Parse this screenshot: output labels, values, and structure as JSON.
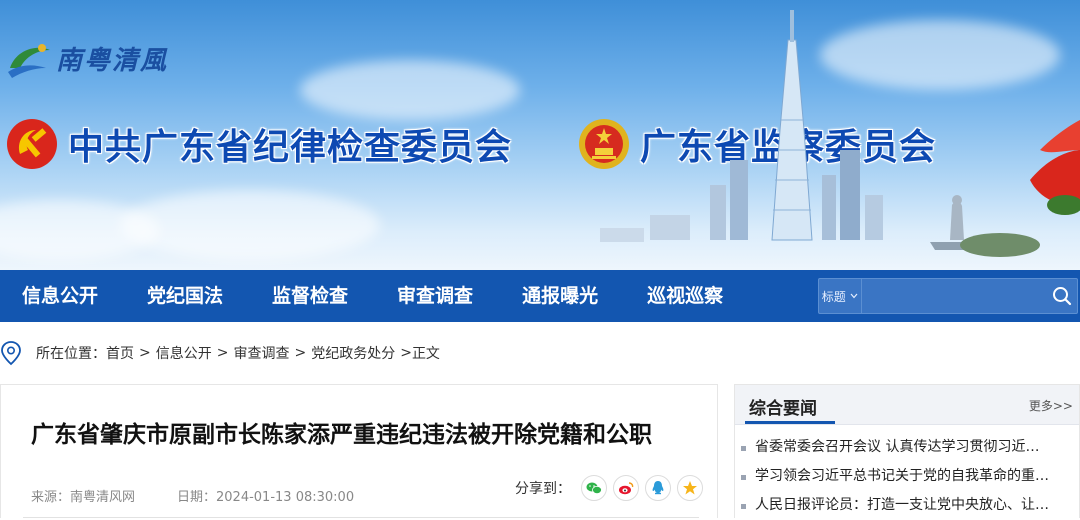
{
  "site": {
    "logo_text": "南粤清風",
    "headline_left": "中共广东省纪律检查委员会",
    "headline_right": "广东省监察委员会"
  },
  "nav": {
    "items": [
      "信息公开",
      "党纪国法",
      "监督检查",
      "审查调查",
      "通报曝光",
      "巡视巡察"
    ],
    "search": {
      "scope_label": "标题",
      "scope_icon": "chevron-down-icon",
      "value": "",
      "button_icon": "search-icon"
    }
  },
  "breadcrumb": {
    "prefix": "所在位置：",
    "items": [
      "首页",
      "信息公开",
      "审查调查",
      "党纪政务处分"
    ],
    "separator": ">",
    "current": "正文"
  },
  "article": {
    "title": "广东省肇庆市原副市长陈家添严重违纪违法被开除党籍和公职",
    "source": "来源：南粤清风网",
    "date": "日期：2024-01-13 08:30:00",
    "share_label": "分享到：",
    "share_icons": [
      "wechat-icon",
      "weibo-icon",
      "qq-icon",
      "qzone-icon"
    ]
  },
  "sidebar": {
    "title": "综合要闻",
    "more": "更多>>",
    "items": [
      "省委常委会召开会议 认真传达学习贯彻习近…",
      "学习领会习近平总书记关于党的自我革命的重…",
      "人民日报评论员：打造一支让党中央放心、让…"
    ]
  },
  "colors": {
    "nav_bg": "#1356b0",
    "headline": "#0d49b2",
    "accent": "#1356b0"
  }
}
